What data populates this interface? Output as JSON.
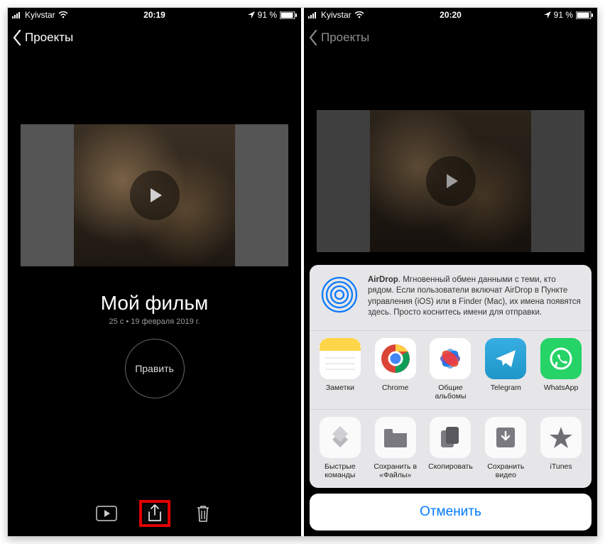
{
  "left": {
    "statusbar": {
      "carrier": "Kyivstar",
      "time": "20:19",
      "battery": "91 %"
    },
    "nav": {
      "back": "Проекты"
    },
    "project": {
      "title": "Мой фильм",
      "meta": "25 с • 19 февраля 2019 г.",
      "edit": "Править"
    }
  },
  "right": {
    "statusbar": {
      "carrier": "Kyivstar",
      "time": "20:20",
      "battery": "91 %"
    },
    "nav": {
      "back": "Проекты"
    },
    "airdrop": {
      "title": "AirDrop",
      "text": ". Мгновенный обмен данными с теми, кто рядом. Если пользователи включат AirDrop в Пункте управления (iOS) или в Finder (Mac), их имена появятся здесь. Просто коснитесь имени для отправки."
    },
    "apps": [
      {
        "label": "Заметки"
      },
      {
        "label": "Chrome"
      },
      {
        "label": "Общие альбомы"
      },
      {
        "label": "Telegram"
      },
      {
        "label": "WhatsApp"
      }
    ],
    "actions": [
      {
        "label": "Быстрые команды"
      },
      {
        "label": "Сохранить в «Файлы»"
      },
      {
        "label": "Скопировать"
      },
      {
        "label": "Сохранить видео"
      },
      {
        "label": "iTunes"
      }
    ],
    "cancel": "Отменить"
  }
}
